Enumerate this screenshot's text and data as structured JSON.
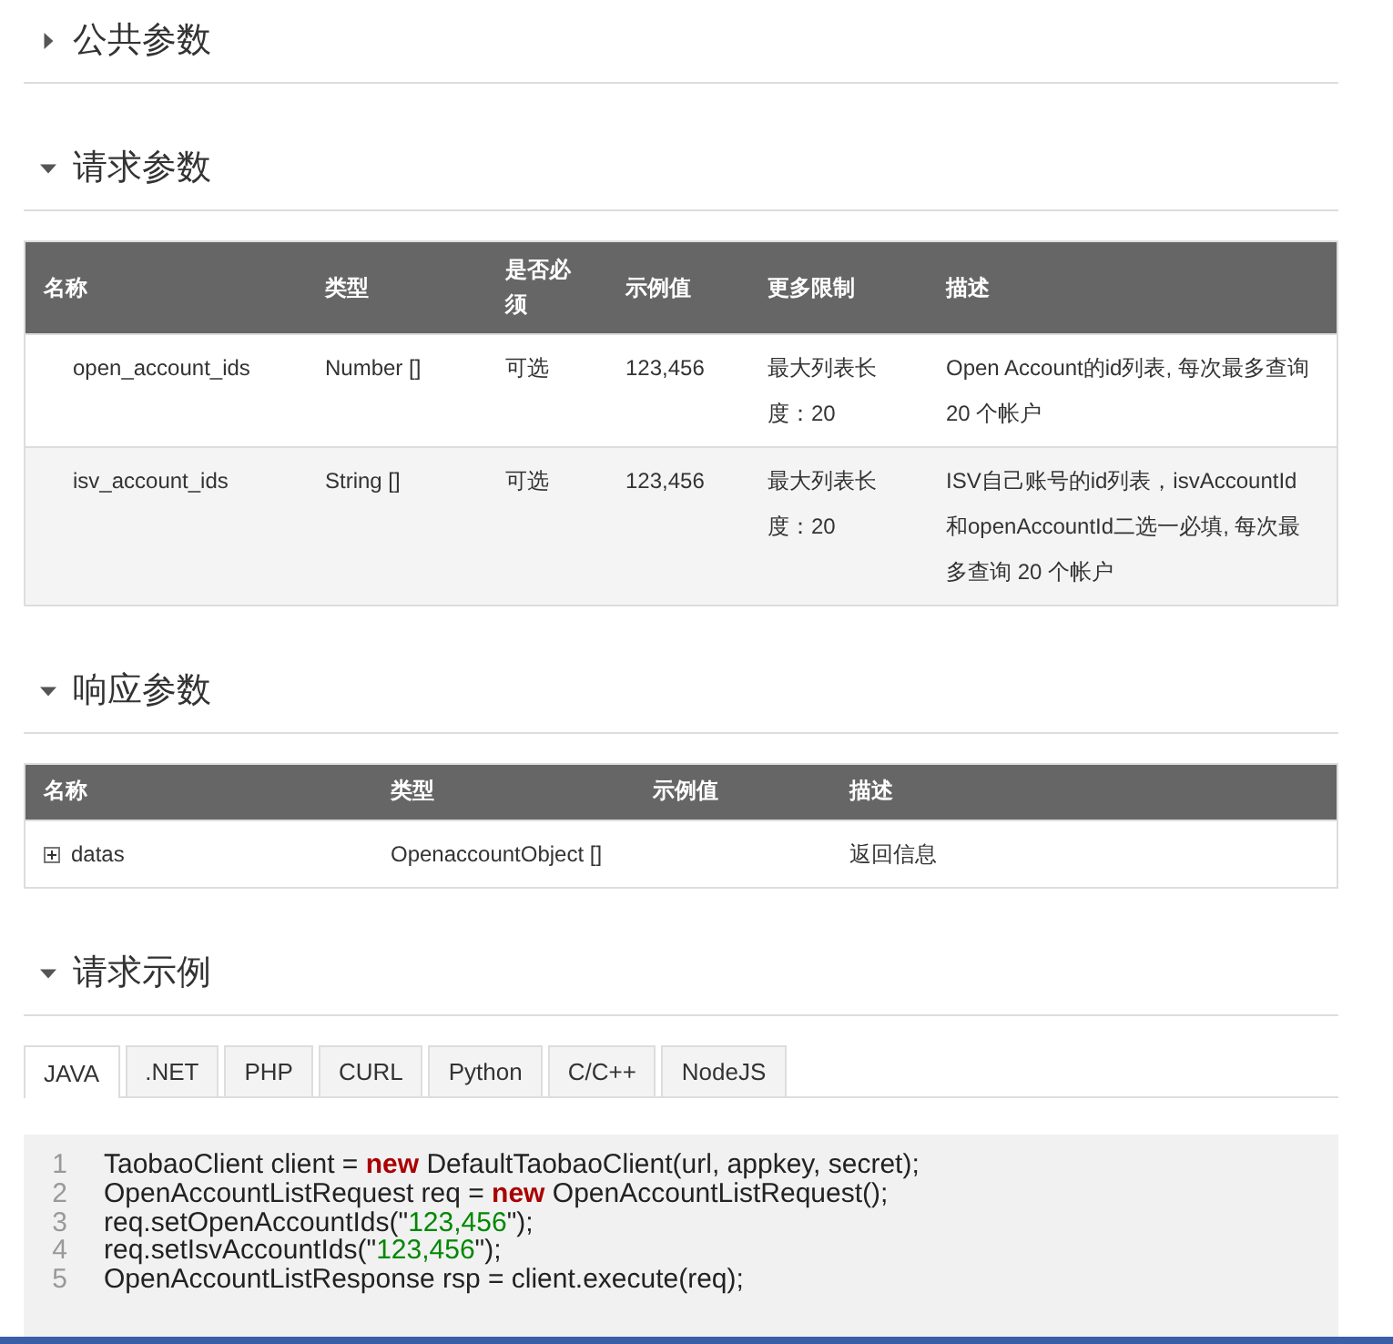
{
  "sections": [
    {
      "title": "公共参数",
      "expanded": false
    },
    {
      "kind": "table",
      "title": "请求参数",
      "expanded": true,
      "table": {
        "columns": [
          "名称",
          "类型",
          "是否必须",
          "示例值",
          "更多限制",
          "描述"
        ],
        "rows": [
          {
            "cells": [
              "open_account_ids",
              "Number []",
              "可选",
              "123,456",
              "最大列表长度：20",
              "Open Account的id列表, 每次最多查询 20 个帐户"
            ]
          },
          {
            "cells": [
              "isv_account_ids",
              "String []",
              "可选",
              "123,456",
              "最大列表长度：20",
              "ISV自己账号的id列表，isvAccountId和openAccountId二选一必填, 每次最多查询 20 个帐户"
            ]
          }
        ]
      }
    },
    {
      "kind": "table",
      "title": "响应参数",
      "expanded": true,
      "table": {
        "columns": [
          "名称",
          "类型",
          "示例值",
          "描述"
        ],
        "rows": [
          {
            "expanded": false,
            "cells": [
              "datas",
              "OpenaccountObject []",
              "",
              "返回信息"
            ]
          }
        ]
      }
    },
    {
      "kind": "code",
      "title": "请求示例",
      "expanded": true,
      "tabs": [
        {
          "label": "JAVA",
          "selected": true
        },
        {
          "label": ".NET",
          "selected": false
        },
        {
          "label": "PHP",
          "selected": false
        },
        {
          "label": "CURL",
          "selected": false
        },
        {
          "label": "Python",
          "selected": false
        },
        {
          "label": "C/C++",
          "selected": false
        },
        {
          "label": "NodeJS",
          "selected": false
        }
      ],
      "lines": [
        {
          "number": "1",
          "tokens": [
            {
              "kind": "plain",
              "text": "TaobaoClient client = "
            },
            {
              "kind": "keyword",
              "text": "new"
            },
            {
              "kind": "plain",
              "text": " DefaultTaobaoClient(url, appkey, secret);"
            }
          ]
        },
        {
          "number": "2",
          "tokens": [
            {
              "kind": "plain",
              "text": "OpenAccountListRequest req = "
            },
            {
              "kind": "keyword",
              "text": "new"
            },
            {
              "kind": "plain",
              "text": " OpenAccountListRequest();"
            }
          ]
        },
        {
          "number": "3",
          "tokens": [
            {
              "kind": "plain",
              "text": "req.setOpenAccountIds(\""
            },
            {
              "kind": "string",
              "text": "123,456"
            },
            {
              "kind": "plain",
              "text": "\");"
            }
          ]
        },
        {
          "number": "4",
          "tokens": [
            {
              "kind": "plain",
              "text": "req.setIsvAccountIds(\""
            },
            {
              "kind": "string",
              "text": "123,456"
            },
            {
              "kind": "plain",
              "text": "\");"
            }
          ]
        },
        {
          "number": "5",
          "tokens": [
            {
              "kind": "plain",
              "text": "OpenAccountListResponse rsp = client.execute(req);"
            }
          ]
        }
      ]
    }
  ]
}
